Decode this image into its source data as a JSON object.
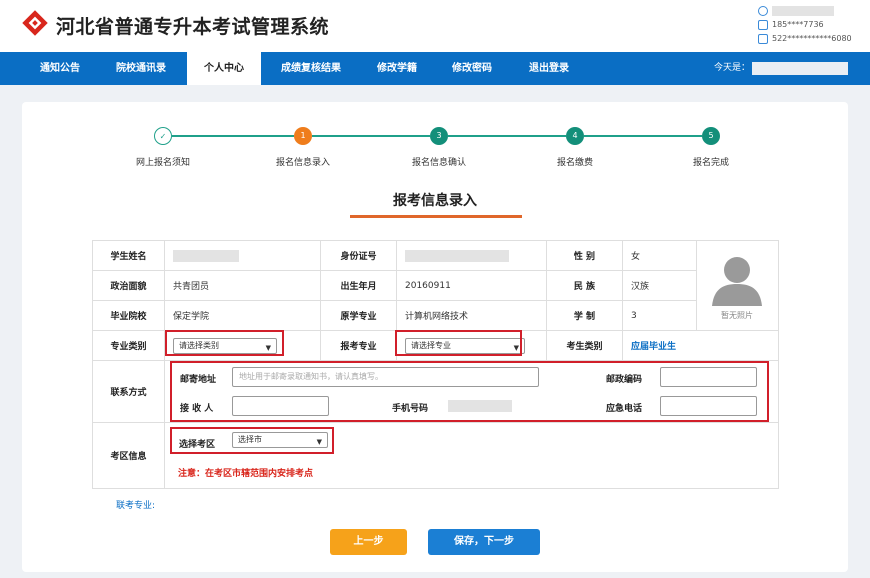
{
  "header": {
    "title": "河北省普通专升本考试管理系统",
    "user": {
      "phone": "185****7736",
      "id_number": "522***********6080"
    }
  },
  "nav": {
    "items": [
      "通知公告",
      "院校通讯录",
      "个人中心",
      "成绩复核结果",
      "修改学籍",
      "修改密码",
      "退出登录"
    ],
    "active_index": 2,
    "today_label": "今天是："
  },
  "steps": [
    {
      "num": "✓",
      "label": "网上报名须知",
      "state": "done"
    },
    {
      "num": "1",
      "label": "报名信息录入",
      "state": "current"
    },
    {
      "num": "3",
      "label": "报名信息确认",
      "state": "todo"
    },
    {
      "num": "4",
      "label": "报名缴费",
      "state": "todo"
    },
    {
      "num": "5",
      "label": "报名完成",
      "state": "todo"
    }
  ],
  "form": {
    "title": "报考信息录入",
    "student_name_label": "学生姓名",
    "id_label": "身份证号",
    "gender_label": "性 别",
    "gender_value": "女",
    "politics_label": "政治面貌",
    "politics_value": "共青团员",
    "birth_label": "出生年月",
    "birth_value": "20160911",
    "ethnicity_label": "民 族",
    "ethnicity_value": "汉族",
    "school_label": "毕业院校",
    "school_value": "保定学院",
    "orig_major_label": "原学专业",
    "orig_major_value": "计算机网络技术",
    "years_label": "学 制",
    "years_value": "3",
    "photo_caption": "暂无照片",
    "category_label": "专业类别",
    "category_select": "请选择类别",
    "major_label": "报考专业",
    "major_select": "请选择专业",
    "student_type_label": "考生类别",
    "student_type_value": "应届毕业生",
    "contact_label": "联系方式",
    "address_label": "邮寄地址",
    "address_placeholder": "地址用于邮寄录取通知书，请认真填写。",
    "postcode_label": "邮政编码",
    "receiver_label": "接 收 人",
    "mobile_label": "手机号码",
    "emergency_label": "应急电话",
    "exam_area_label": "考区信息",
    "choose_area_label": "选择考区",
    "city_select": "选择市",
    "area_note": "注意：在考区市辖范围内安排考点",
    "joint_major_label": "联考专业:"
  },
  "buttons": {
    "prev": "上一步",
    "next": "保存，下一步"
  },
  "colors": {
    "nav": "#0a6ec4",
    "accent": "#ef7d1c",
    "step": "#138f7a",
    "highlight": "#d11f2a",
    "prev_button": "#f6a21a",
    "next_button": "#1b7fd4"
  }
}
